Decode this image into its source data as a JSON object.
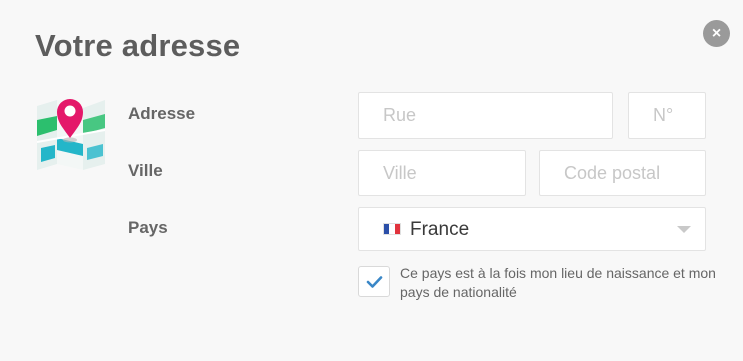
{
  "dialog": {
    "title": "Votre adresse",
    "close_icon": "close-icon",
    "close_symbol": "×"
  },
  "form": {
    "address": {
      "label": "Adresse",
      "street_placeholder": "Rue",
      "street_value": "",
      "number_placeholder": "N°",
      "number_value": ""
    },
    "city": {
      "label": "Ville",
      "city_placeholder": "Ville",
      "city_value": "",
      "postal_placeholder": "Code postal",
      "postal_value": ""
    },
    "country": {
      "label": "Pays",
      "selected": "France",
      "flag_icon": "france-flag-icon"
    },
    "same_country": {
      "checked": true,
      "label": "Ce pays est à la fois mon lieu de naissance et mon pays de nationalité"
    }
  },
  "colors": {
    "title": "#5d5d5d",
    "pin": "#e4186a",
    "map_green": "#2cbf6e",
    "map_teal": "#24b6c9",
    "check": "#3a87c7"
  }
}
